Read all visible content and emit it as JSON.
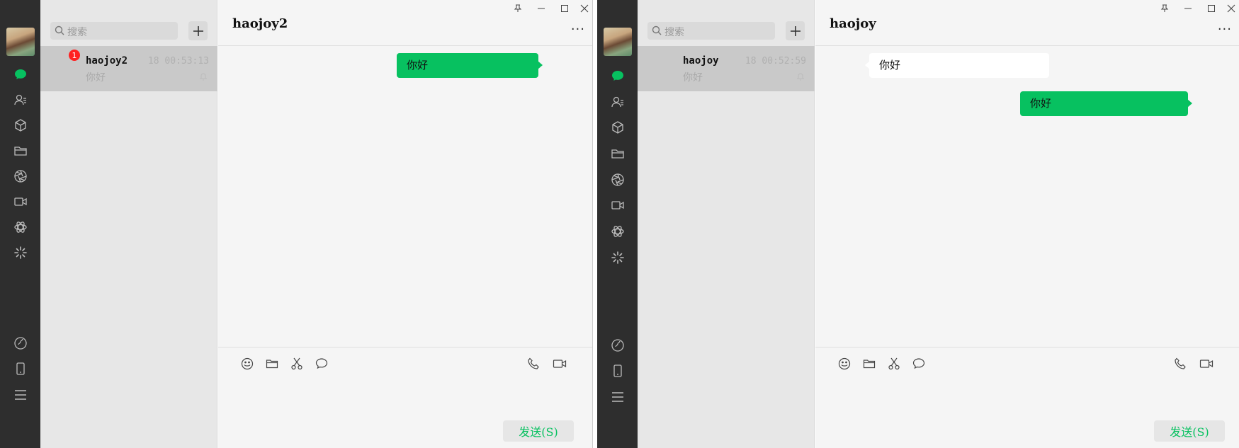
{
  "windows": [
    {
      "search_placeholder": "搜索",
      "conversation": {
        "name": "haojoy2",
        "time": "18 00:53:13",
        "preview": "你好",
        "unread": "1"
      },
      "chat_title": "haojoy2",
      "messages": [
        {
          "from": "me",
          "text": "你好"
        }
      ],
      "send_label": "发送(S)"
    },
    {
      "search_placeholder": "搜索",
      "conversation": {
        "name": "haojoy",
        "time": "18 00:52:59",
        "preview": "你好"
      },
      "chat_title": "haojoy",
      "messages": [
        {
          "from": "them",
          "text": "你好"
        },
        {
          "from": "me",
          "text": "你好"
        }
      ],
      "send_label": "发送(S)"
    }
  ],
  "window_controls": [
    "pin-icon",
    "minimize-icon",
    "maximize-icon",
    "close-icon"
  ],
  "more_label": "···",
  "sidebar_icons": [
    "chat-icon",
    "contacts-icon",
    "favorites-icon",
    "files-icon",
    "moments-icon",
    "channels-icon",
    "mini-programs-icon",
    "search-discover-icon"
  ],
  "sidebar_bottom_icons": [
    "mini-program-panel-icon",
    "phone-icon",
    "menu-icon"
  ],
  "toolbar_icons": [
    "emoji-icon",
    "folder-icon",
    "screenshot-icon",
    "chat-history-icon"
  ],
  "toolbar_right_icons": [
    "voice-call-icon",
    "video-call-icon"
  ],
  "colors": {
    "accent": "#07c160",
    "sidebar": "#2e2e2e",
    "badge": "#ff2222"
  }
}
